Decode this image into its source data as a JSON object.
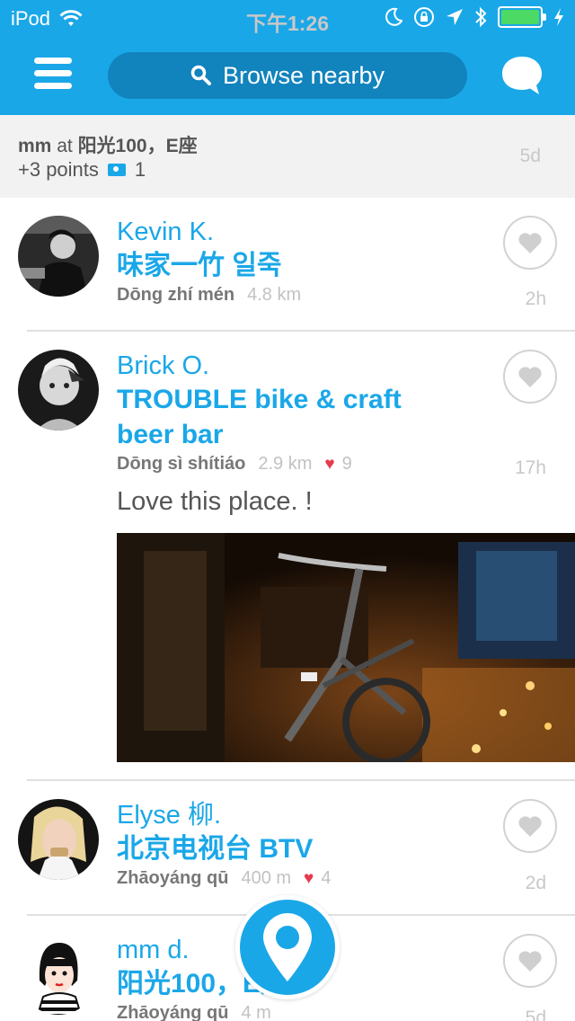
{
  "status_bar": {
    "carrier": "iPod",
    "time": "下午1:26"
  },
  "nav": {
    "search_label": "Browse nearby"
  },
  "activity": {
    "user": "mm",
    "connector": "at",
    "place": "阳光100，E座",
    "points": "+3 points",
    "photo_count": "1",
    "age": "5d"
  },
  "feed": [
    {
      "name": "Kevin K.",
      "venue": "味家一竹 일죽",
      "area": "Dōng zhí mén",
      "distance": "4.8 km",
      "likes": "",
      "time": "2h",
      "comment": ""
    },
    {
      "name": "Brick O.",
      "venue": "TROUBLE bike & craft beer bar",
      "area": "Dōng sì shítiáo",
      "distance": "2.9 km",
      "likes": "9",
      "time": "17h",
      "comment": "Love this place. !"
    },
    {
      "name": "Elyse 柳.",
      "venue": "北京电视台 BTV",
      "area": "Zhāoyáng qū",
      "distance": "400 m",
      "likes": "4",
      "time": "2d",
      "comment": ""
    },
    {
      "name": "mm d.",
      "venue": "阳光100，E座",
      "area": "Zhāoyáng qū",
      "distance": "4 m",
      "likes": "",
      "time": "5d",
      "comment": ""
    }
  ],
  "colors": {
    "accent": "#1aa7e8",
    "nav_pill": "#1183bd",
    "heart": "#e63a4c"
  },
  "icons": [
    "menu-icon",
    "search-icon",
    "chat-bubble-icon",
    "camera-icon",
    "heart-icon",
    "location-pin-icon"
  ]
}
